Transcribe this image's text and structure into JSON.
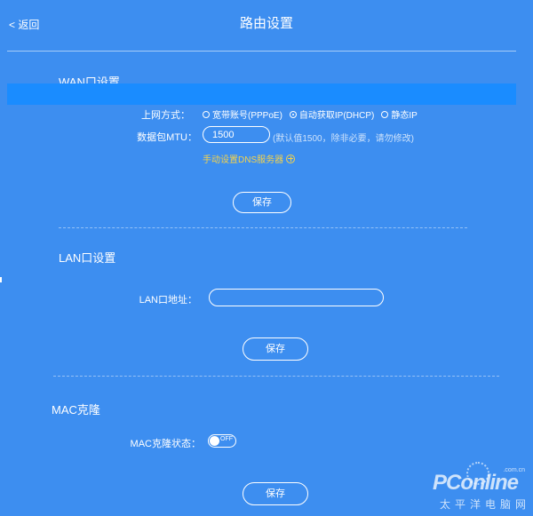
{
  "header": {
    "back_label": "< 返回",
    "title": "路由设置"
  },
  "wan": {
    "section_title": "WAN口设置",
    "mode_label": "上网方式：",
    "modes": [
      {
        "label": "宽带账号(PPPoE)",
        "selected": false
      },
      {
        "label": "自动获取IP(DHCP)",
        "selected": true
      },
      {
        "label": "静态IP",
        "selected": false
      }
    ],
    "mtu_label": "数据包MTU：",
    "mtu_value": "1500",
    "mtu_hint": "(默认值1500，除非必要，请勿修改)",
    "dns_link": "手动设置DNS服务器",
    "save_label": "保存"
  },
  "lan": {
    "section_title": "LAN口设置",
    "address_label": "LAN口地址：",
    "address_value": "",
    "save_label": "保存"
  },
  "mac": {
    "section_title": "MAC克隆",
    "status_label": "MAC克隆状态：",
    "toggle_state": "OFF",
    "save_label": "保存"
  },
  "watermark": {
    "brand": "PConline",
    "domain": ".com.cn",
    "subtitle": "太平洋电脑网"
  },
  "colors": {
    "background": "#3d8ef0",
    "highlight_bar": "#1a8cff",
    "link": "#f5d34a"
  }
}
